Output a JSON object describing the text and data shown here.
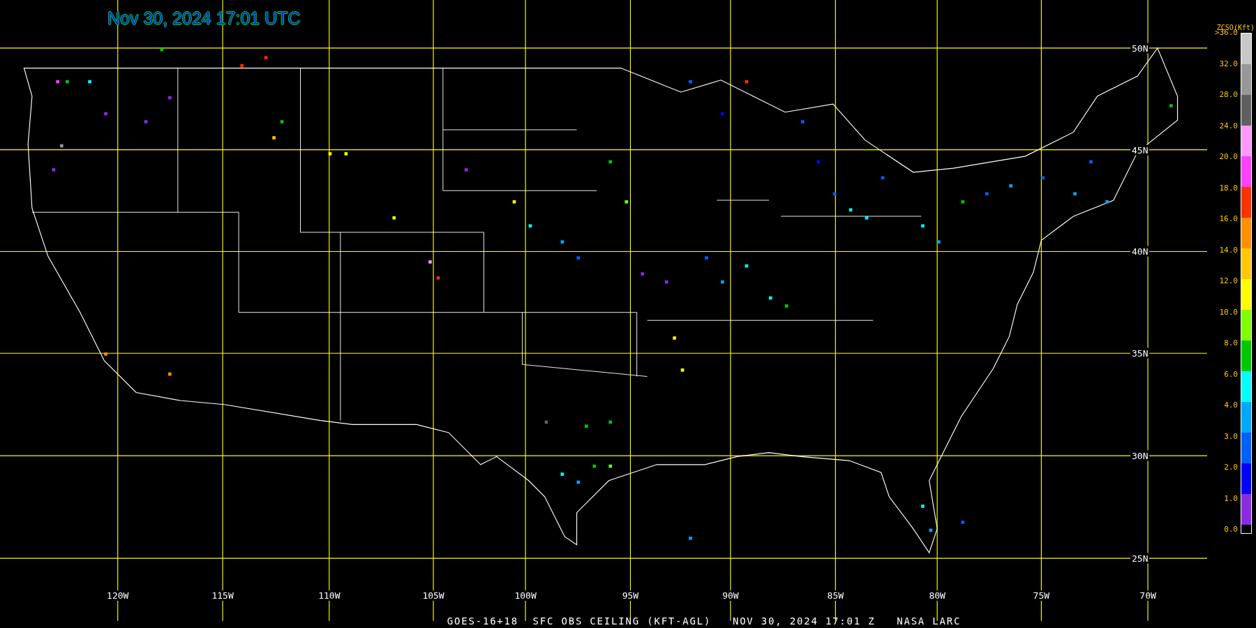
{
  "title": "Nov 30, 2024 17:01 UTC",
  "latitude_labels": [
    "50N",
    "45N",
    "40N",
    "35N",
    "30N",
    "25N"
  ],
  "longitude_labels": [
    "120W",
    "115W",
    "110W",
    "105W",
    "100W",
    "95W",
    "90W",
    "85W",
    "80W",
    "75W",
    "70W"
  ],
  "footer": "GOES-16+18  SFC OBS CEILING (KFT-AGL)   NOV 30, 2024 17:01 Z   NASA LARC",
  "legend": {
    "title": "ZCSO(Kft)",
    "values": [
      ">36.0",
      "32.0",
      "28.0",
      "24.0",
      "20.0",
      "18.0",
      "16.0",
      "14.0",
      "12.0",
      "10.0",
      "8.0",
      "6.0",
      "4.0",
      "3.0",
      "2.0",
      "1.0",
      "0.0"
    ],
    "bins": [
      {
        "color": "#c8c8c8"
      },
      {
        "color": "#989898"
      },
      {
        "color": "#606060"
      },
      {
        "color": "#ff98ff"
      },
      {
        "color": "#ff40ff"
      },
      {
        "color": "#ff3000"
      },
      {
        "color": "#ff9000"
      },
      {
        "color": "#ffc800"
      },
      {
        "color": "#ffff00"
      },
      {
        "color": "#80ff00"
      },
      {
        "color": "#00c800"
      },
      {
        "color": "#00ffff"
      },
      {
        "color": "#00a8ff"
      },
      {
        "color": "#0060ff"
      },
      {
        "color": "#0000ff"
      },
      {
        "color": "#8a2be2"
      }
    ]
  }
}
